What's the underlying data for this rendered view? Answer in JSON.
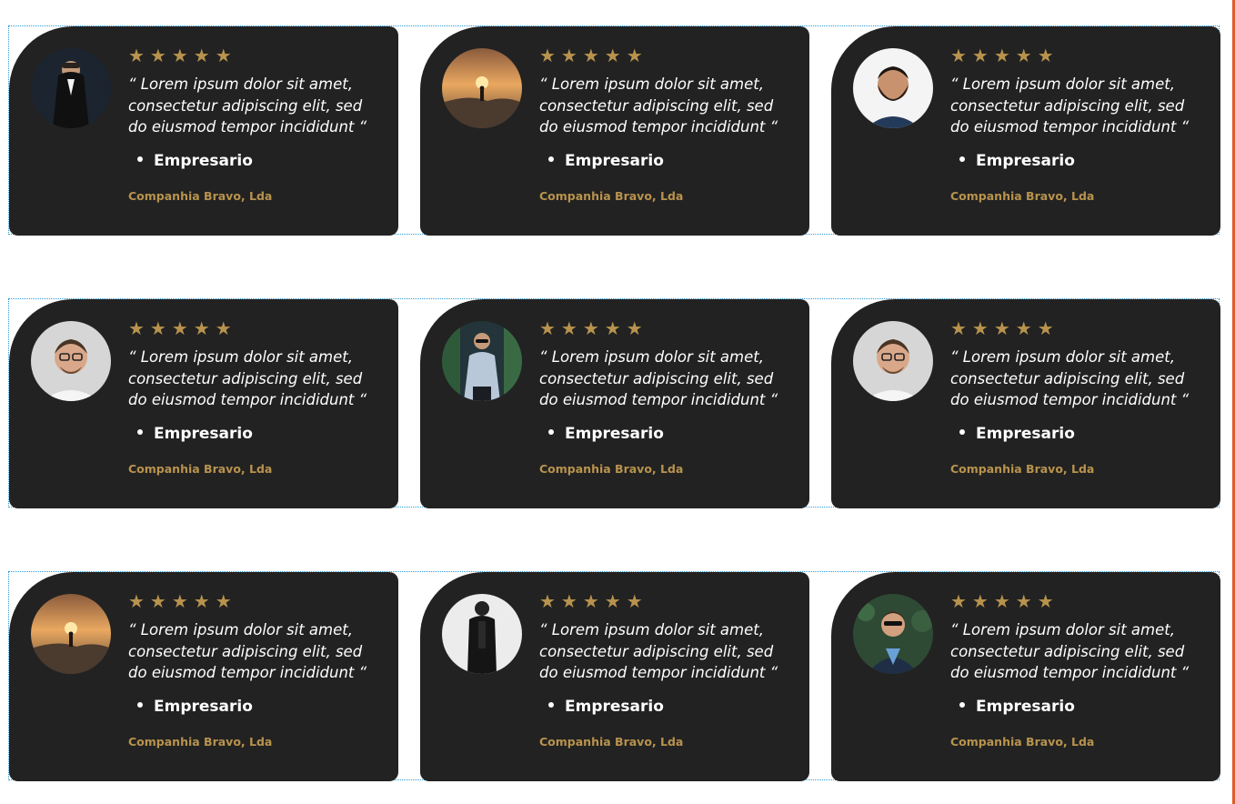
{
  "colors": {
    "card_background": "#222222",
    "accent_gold": "#b8934d",
    "text_white": "#ffffff",
    "guide_blue": "#2a9ad6",
    "edge_orange": "#e05a2b"
  },
  "testimonials": [
    {
      "stars": "★★★★★",
      "quote": "“ Lorem ipsum dolor sit amet, consectetur adipiscing elit, sed do eiusmod tempor incididunt “",
      "role": "Empresario",
      "company": "Companhia Bravo, Lda",
      "avatar": "man-in-suit-avatar"
    },
    {
      "stars": "★★★★★",
      "quote": "“ Lorem ipsum dolor sit amet, consectetur adipiscing elit, sed do eiusmod tempor incididunt “",
      "role": "Empresario",
      "company": "Companhia Bravo, Lda",
      "avatar": "sunset-hiker-avatar"
    },
    {
      "stars": "★★★★★",
      "quote": "“ Lorem ipsum dolor sit amet, consectetur adipiscing elit, sed do eiusmod tempor incididunt “",
      "role": "Empresario",
      "company": "Companhia Bravo, Lda",
      "avatar": "bearded-man-avatar"
    },
    {
      "stars": "★★★★★",
      "quote": "“ Lorem ipsum dolor sit amet, consectetur adipiscing elit, sed do eiusmod tempor incididunt “",
      "role": "Empresario",
      "company": "Companhia Bravo, Lda",
      "avatar": "man-with-glasses-avatar"
    },
    {
      "stars": "★★★★★",
      "quote": "“ Lorem ipsum dolor sit amet, consectetur adipiscing elit, sed do eiusmod tempor incididunt “",
      "role": "Empresario",
      "company": "Companhia Bravo, Lda",
      "avatar": "man-with-sunglasses-avatar"
    },
    {
      "stars": "★★★★★",
      "quote": "“ Lorem ipsum dolor sit amet, consectetur adipiscing elit, sed do eiusmod tempor incididunt “",
      "role": "Empresario",
      "company": "Companhia Bravo, Lda",
      "avatar": "man-with-glasses-avatar"
    },
    {
      "stars": "★★★★★",
      "quote": "“ Lorem ipsum dolor sit amet, consectetur adipiscing elit, sed do eiusmod tempor incididunt “",
      "role": "Empresario",
      "company": "Companhia Bravo, Lda",
      "avatar": "sunset-hiker-avatar"
    },
    {
      "stars": "★★★★★",
      "quote": "“ Lorem ipsum dolor sit amet, consectetur adipiscing elit, sed do eiusmod tempor incididunt “",
      "role": "Empresario",
      "company": "Companhia Bravo, Lda",
      "avatar": "man-in-black-coat-avatar"
    },
    {
      "stars": "★★★★★",
      "quote": "“ Lorem ipsum dolor sit amet, consectetur adipiscing elit, sed do eiusmod tempor incididunt “",
      "role": "Empresario",
      "company": "Companhia Bravo, Lda",
      "avatar": "man-adjusting-tie-avatar"
    }
  ]
}
